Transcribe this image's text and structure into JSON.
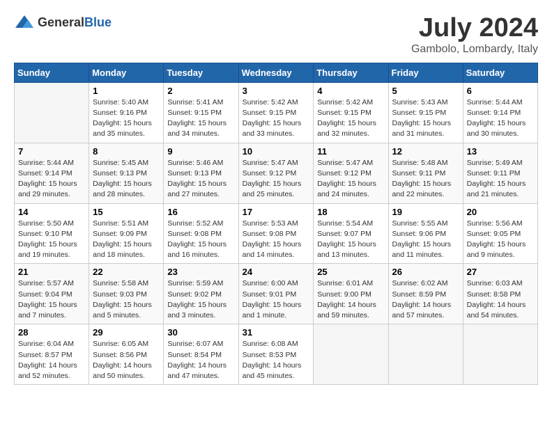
{
  "logo": {
    "general": "General",
    "blue": "Blue"
  },
  "header": {
    "title": "July 2024",
    "subtitle": "Gambolo, Lombardy, Italy"
  },
  "weekdays": [
    "Sunday",
    "Monday",
    "Tuesday",
    "Wednesday",
    "Thursday",
    "Friday",
    "Saturday"
  ],
  "weeks": [
    [
      {
        "day": "",
        "info": ""
      },
      {
        "day": "1",
        "info": "Sunrise: 5:40 AM\nSunset: 9:16 PM\nDaylight: 15 hours\nand 35 minutes."
      },
      {
        "day": "2",
        "info": "Sunrise: 5:41 AM\nSunset: 9:15 PM\nDaylight: 15 hours\nand 34 minutes."
      },
      {
        "day": "3",
        "info": "Sunrise: 5:42 AM\nSunset: 9:15 PM\nDaylight: 15 hours\nand 33 minutes."
      },
      {
        "day": "4",
        "info": "Sunrise: 5:42 AM\nSunset: 9:15 PM\nDaylight: 15 hours\nand 32 minutes."
      },
      {
        "day": "5",
        "info": "Sunrise: 5:43 AM\nSunset: 9:15 PM\nDaylight: 15 hours\nand 31 minutes."
      },
      {
        "day": "6",
        "info": "Sunrise: 5:44 AM\nSunset: 9:14 PM\nDaylight: 15 hours\nand 30 minutes."
      }
    ],
    [
      {
        "day": "7",
        "info": "Sunrise: 5:44 AM\nSunset: 9:14 PM\nDaylight: 15 hours\nand 29 minutes."
      },
      {
        "day": "8",
        "info": "Sunrise: 5:45 AM\nSunset: 9:13 PM\nDaylight: 15 hours\nand 28 minutes."
      },
      {
        "day": "9",
        "info": "Sunrise: 5:46 AM\nSunset: 9:13 PM\nDaylight: 15 hours\nand 27 minutes."
      },
      {
        "day": "10",
        "info": "Sunrise: 5:47 AM\nSunset: 9:12 PM\nDaylight: 15 hours\nand 25 minutes."
      },
      {
        "day": "11",
        "info": "Sunrise: 5:47 AM\nSunset: 9:12 PM\nDaylight: 15 hours\nand 24 minutes."
      },
      {
        "day": "12",
        "info": "Sunrise: 5:48 AM\nSunset: 9:11 PM\nDaylight: 15 hours\nand 22 minutes."
      },
      {
        "day": "13",
        "info": "Sunrise: 5:49 AM\nSunset: 9:11 PM\nDaylight: 15 hours\nand 21 minutes."
      }
    ],
    [
      {
        "day": "14",
        "info": "Sunrise: 5:50 AM\nSunset: 9:10 PM\nDaylight: 15 hours\nand 19 minutes."
      },
      {
        "day": "15",
        "info": "Sunrise: 5:51 AM\nSunset: 9:09 PM\nDaylight: 15 hours\nand 18 minutes."
      },
      {
        "day": "16",
        "info": "Sunrise: 5:52 AM\nSunset: 9:08 PM\nDaylight: 15 hours\nand 16 minutes."
      },
      {
        "day": "17",
        "info": "Sunrise: 5:53 AM\nSunset: 9:08 PM\nDaylight: 15 hours\nand 14 minutes."
      },
      {
        "day": "18",
        "info": "Sunrise: 5:54 AM\nSunset: 9:07 PM\nDaylight: 15 hours\nand 13 minutes."
      },
      {
        "day": "19",
        "info": "Sunrise: 5:55 AM\nSunset: 9:06 PM\nDaylight: 15 hours\nand 11 minutes."
      },
      {
        "day": "20",
        "info": "Sunrise: 5:56 AM\nSunset: 9:05 PM\nDaylight: 15 hours\nand 9 minutes."
      }
    ],
    [
      {
        "day": "21",
        "info": "Sunrise: 5:57 AM\nSunset: 9:04 PM\nDaylight: 15 hours\nand 7 minutes."
      },
      {
        "day": "22",
        "info": "Sunrise: 5:58 AM\nSunset: 9:03 PM\nDaylight: 15 hours\nand 5 minutes."
      },
      {
        "day": "23",
        "info": "Sunrise: 5:59 AM\nSunset: 9:02 PM\nDaylight: 15 hours\nand 3 minutes."
      },
      {
        "day": "24",
        "info": "Sunrise: 6:00 AM\nSunset: 9:01 PM\nDaylight: 15 hours\nand 1 minute."
      },
      {
        "day": "25",
        "info": "Sunrise: 6:01 AM\nSunset: 9:00 PM\nDaylight: 14 hours\nand 59 minutes."
      },
      {
        "day": "26",
        "info": "Sunrise: 6:02 AM\nSunset: 8:59 PM\nDaylight: 14 hours\nand 57 minutes."
      },
      {
        "day": "27",
        "info": "Sunrise: 6:03 AM\nSunset: 8:58 PM\nDaylight: 14 hours\nand 54 minutes."
      }
    ],
    [
      {
        "day": "28",
        "info": "Sunrise: 6:04 AM\nSunset: 8:57 PM\nDaylight: 14 hours\nand 52 minutes."
      },
      {
        "day": "29",
        "info": "Sunrise: 6:05 AM\nSunset: 8:56 PM\nDaylight: 14 hours\nand 50 minutes."
      },
      {
        "day": "30",
        "info": "Sunrise: 6:07 AM\nSunset: 8:54 PM\nDaylight: 14 hours\nand 47 minutes."
      },
      {
        "day": "31",
        "info": "Sunrise: 6:08 AM\nSunset: 8:53 PM\nDaylight: 14 hours\nand 45 minutes."
      },
      {
        "day": "",
        "info": ""
      },
      {
        "day": "",
        "info": ""
      },
      {
        "day": "",
        "info": ""
      }
    ]
  ]
}
